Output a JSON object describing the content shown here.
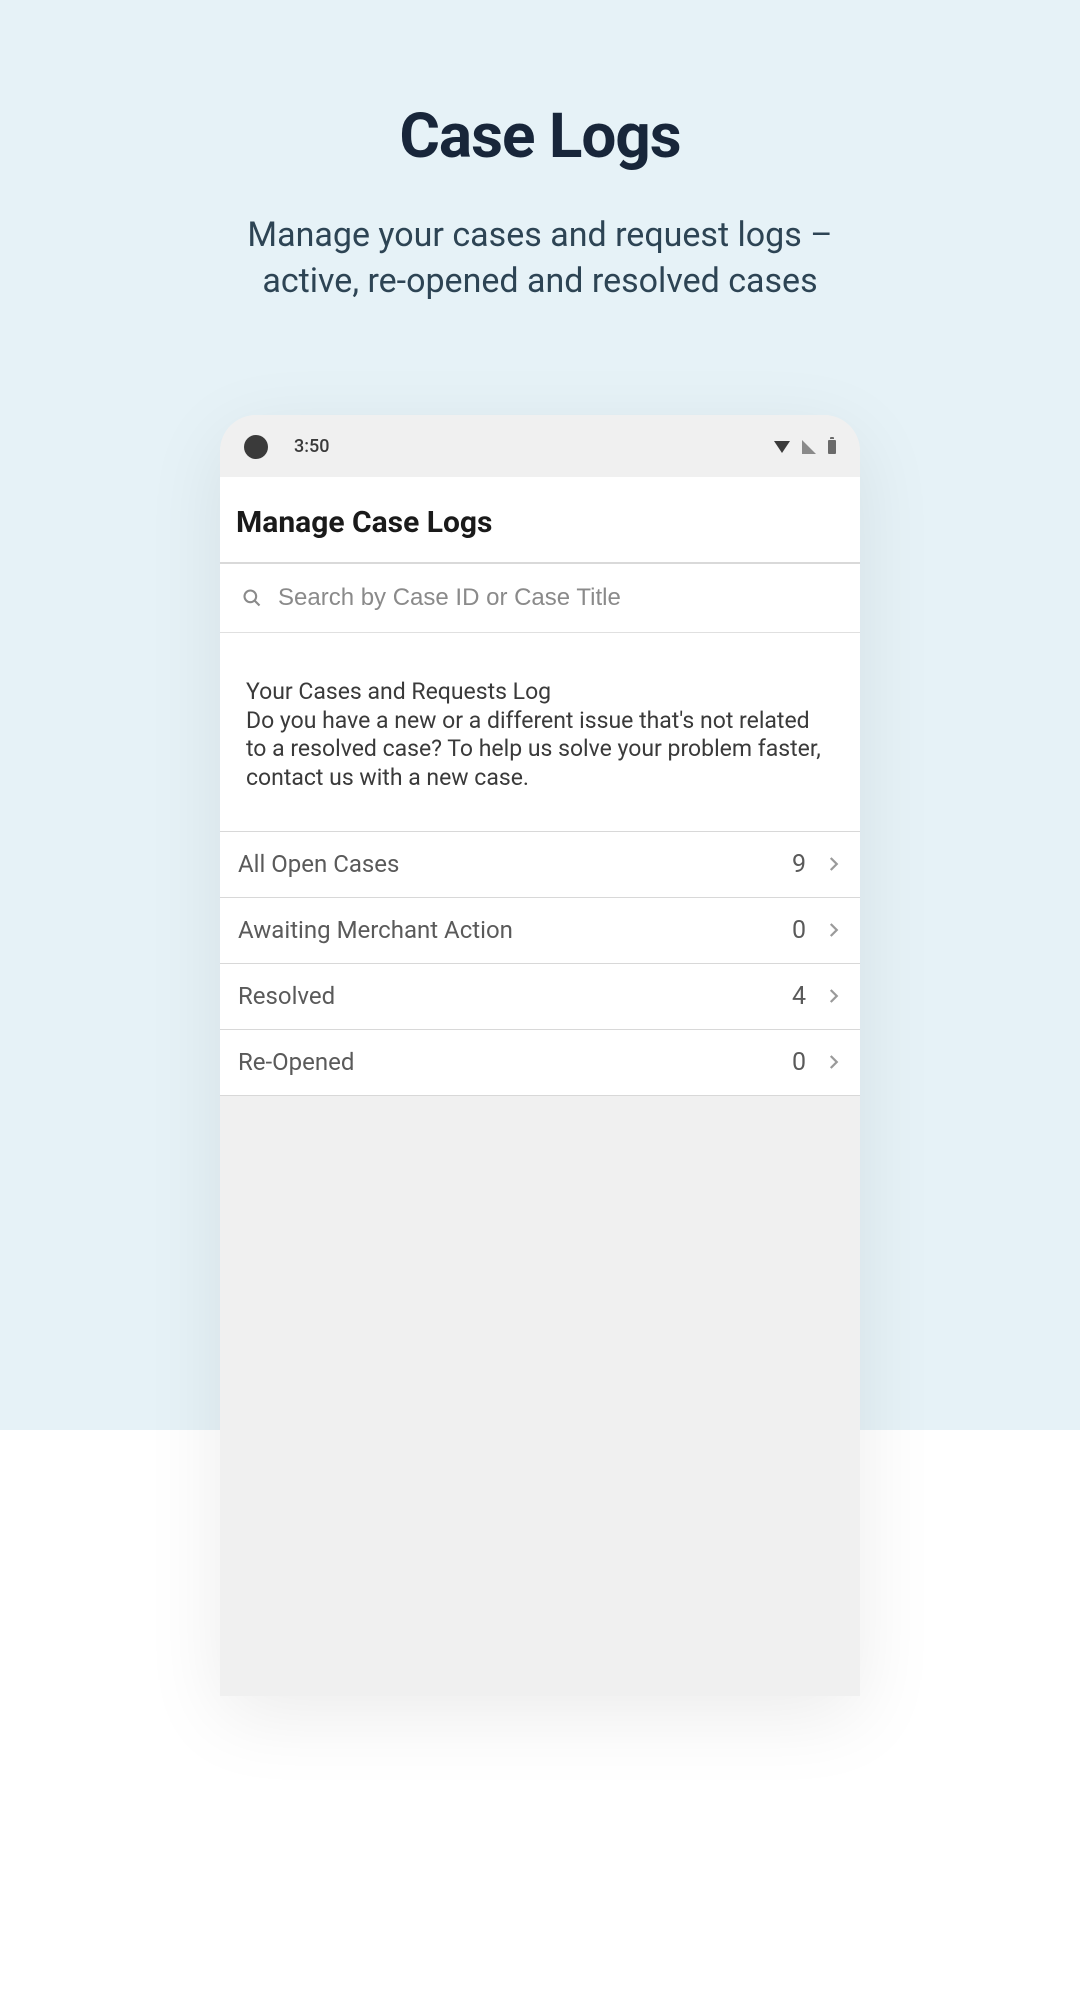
{
  "hero": {
    "title": "Case Logs",
    "subtitle": "Manage your cases and request logs – active, re-opened and resolved cases"
  },
  "statusBar": {
    "time": "3:50"
  },
  "appHeader": {
    "title": "Manage Case Logs"
  },
  "search": {
    "placeholder": "Search by Case ID or Case Title"
  },
  "info": {
    "title": "Your Cases and Requests Log",
    "text": "Do you have a new or a different issue that's not related to a resolved case? To help us solve your problem faster, contact us with a new case."
  },
  "cases": [
    {
      "label": "All Open Cases",
      "count": "9"
    },
    {
      "label": "Awaiting Merchant Action",
      "count": "0"
    },
    {
      "label": "Resolved",
      "count": "4"
    },
    {
      "label": "Re-Opened",
      "count": "0"
    }
  ]
}
